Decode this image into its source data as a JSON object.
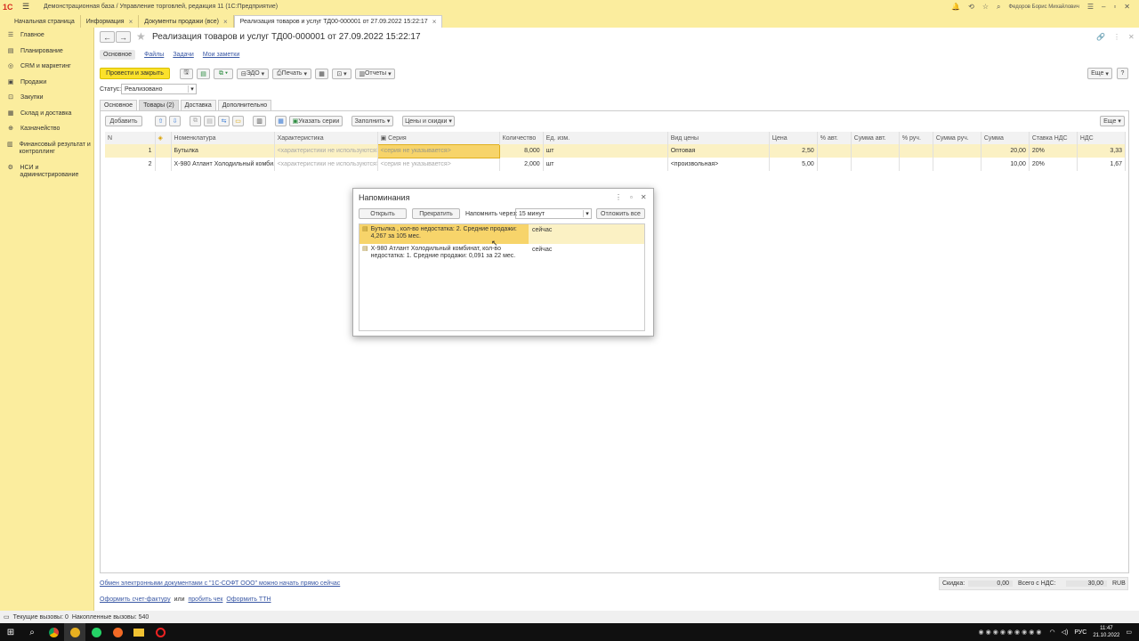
{
  "window": {
    "title": "Демонстрационная база / Управление торговлей, редакция 11  (1С:Предприятие)",
    "user": "Федоров Борис Михайлович"
  },
  "tabs": [
    {
      "label": "Начальная страница"
    },
    {
      "label": "Информация"
    },
    {
      "label": "Документы продажи (все)"
    },
    {
      "label": "Реализация товаров и услуг ТД00-000001 от 27.09.2022 15:22:17"
    }
  ],
  "sidebar": {
    "items": [
      {
        "label": "Главное",
        "icon": "menu-icon"
      },
      {
        "label": "Планирование",
        "icon": "planning-icon"
      },
      {
        "label": "CRM и маркетинг",
        "icon": "crm-icon"
      },
      {
        "label": "Продажи",
        "icon": "sales-icon"
      },
      {
        "label": "Закупки",
        "icon": "purchases-icon"
      },
      {
        "label": "Склад и доставка",
        "icon": "warehouse-icon"
      },
      {
        "label": "Казначейство",
        "icon": "treasury-icon"
      },
      {
        "label": "Финансовый результат и контроллинг",
        "icon": "finance-icon"
      },
      {
        "label": "НСИ и администрирование",
        "icon": "settings-icon"
      }
    ]
  },
  "doc": {
    "title": "Реализация товаров и услуг ТД00-000001 от 27.09.2022 15:22:17",
    "nav": {
      "main": "Основное",
      "files": "Файлы",
      "tasks": "Задачи",
      "notes": "Мои заметки"
    },
    "toolbar": {
      "post_close": "Провести и закрыть",
      "edo": "ЭДО",
      "print": "Печать",
      "reports": "Отчеты",
      "more": "Еще",
      "help": "?"
    },
    "status": {
      "label": "Статус:",
      "value": "Реализовано"
    },
    "subtabs": [
      "Основное",
      "Товары (2)",
      "Доставка",
      "Дополнительно"
    ],
    "grid_toolbar": {
      "add": "Добавить",
      "series": "Указать серии",
      "fill": "Заполнить",
      "prices": "Цены и скидки",
      "more": "Еще"
    },
    "columns": [
      "N",
      "Номенклатура",
      "Характеристика",
      "Серия",
      "Количество",
      "Ед. изм.",
      "Вид цены",
      "Цена",
      "% авт.",
      "Сумма авт.",
      "% руч.",
      "Сумма руч.",
      "Сумма",
      "Ставка НДС",
      "НДС"
    ],
    "rows": [
      {
        "n": "1",
        "item": "Бутылка",
        "char": "<характеристики не используются>",
        "series": "<серия не указывается>",
        "qty": "8,000",
        "unit": "шт",
        "price_type": "Оптовая",
        "price": "2,50",
        "sum": "20,00",
        "vat_rate": "20%",
        "vat": "3,33"
      },
      {
        "n": "2",
        "item": "X-980 Атлант Холодильный комби...",
        "char": "<характеристики не используются>",
        "series": "<серия не указывается>",
        "qty": "2,000",
        "unit": "шт",
        "price_type": "<произвольная>",
        "price": "5,00",
        "sum": "10,00",
        "vat_rate": "20%",
        "vat": "1,67"
      }
    ],
    "footer": {
      "edo_link": "Обмен электронными документами с \"1С-СОФТ ООО\" можно начать прямо сейчас",
      "invoice_link": "Оформить счет-фактуру",
      "or": "или",
      "check_link": "пробить чек",
      "ttn_link": "Оформить ТТН",
      "discount_label": "Скидка:",
      "discount": "0,00",
      "total_label": "Всего с НДС:",
      "total": "30,00",
      "currency": "RUB"
    }
  },
  "dialog": {
    "title": "Напоминания",
    "open": "Открыть",
    "stop": "Прекратить",
    "remind_label": "Напомнить через:",
    "remind_value": "15 минут",
    "postpone": "Отложить все",
    "items": [
      {
        "text": "Бутылка , кол-во недостатка: 2. Средние продажи: 4,267 за 105 мес.",
        "when": "сейчас"
      },
      {
        "text": "X-980 Атлант Холодильный комбинат, кол-во недостатка: 1. Средние продажи: 0,091 за 22 мес.",
        "when": "сейчас"
      }
    ]
  },
  "statusbar": {
    "current": "Текущие вызовы: 0",
    "accum": "Накопленные вызовы: 540"
  },
  "tray": {
    "lang": "РУС",
    "time": "11:47",
    "date": "21.10.2022"
  }
}
